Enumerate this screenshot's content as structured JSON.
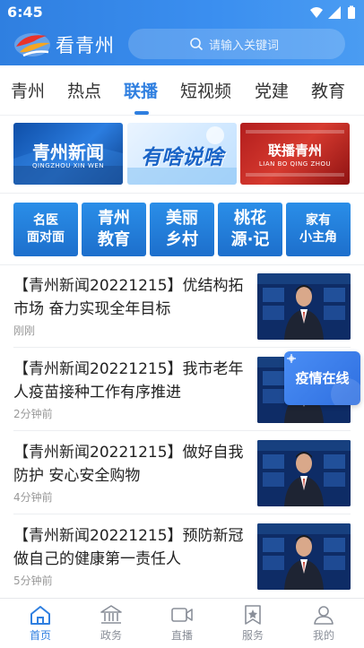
{
  "status_bar": {
    "time": "6:45"
  },
  "header": {
    "brand": "看青州",
    "search_placeholder": "请输入关键词"
  },
  "tabs": [
    {
      "label": "青州"
    },
    {
      "label": "热点"
    },
    {
      "label": "联播",
      "active": true
    },
    {
      "label": "短视频"
    },
    {
      "label": "党建"
    },
    {
      "label": "教育"
    }
  ],
  "banners": [
    {
      "title": "青州新闻",
      "subtitle": "QINGZHOU XIN WEN"
    },
    {
      "title": "有啥说啥"
    },
    {
      "title": "联播青州",
      "subtitle": "LIAN BO QING ZHOU"
    }
  ],
  "categories": [
    {
      "line1": "名医",
      "line2": "面对面"
    },
    {
      "line1": "青州",
      "line2": "教育"
    },
    {
      "line1": "美丽",
      "line2": "乡村"
    },
    {
      "line1": "桃花",
      "line2": "源·记"
    },
    {
      "line1": "家有",
      "line2": "小主角"
    }
  ],
  "news": [
    {
      "title": "【青州新闻20221215】优结构拓市场 奋力实现全年目标",
      "time": "刚刚"
    },
    {
      "title": "【青州新闻20221215】我市老年人疫苗接种工作有序推进",
      "time": "2分钟前"
    },
    {
      "title": "【青州新闻20221215】做好自我防护 安心安全购物",
      "time": "4分钟前"
    },
    {
      "title": "【青州新闻20221215】预防新冠 做自己的健康第一责任人",
      "time": "5分钟前"
    }
  ],
  "float_badge": {
    "label": "疫情在线"
  },
  "bottom_nav": [
    {
      "label": "首页",
      "icon": "home-icon",
      "active": true
    },
    {
      "label": "政务",
      "icon": "government-icon"
    },
    {
      "label": "直播",
      "icon": "live-video-icon"
    },
    {
      "label": "服务",
      "icon": "service-bookmark-icon"
    },
    {
      "label": "我的",
      "icon": "user-icon"
    }
  ],
  "colors": {
    "primary": "#2f7fe0",
    "category_bg": "#1d6fcc",
    "muted": "#999999"
  }
}
